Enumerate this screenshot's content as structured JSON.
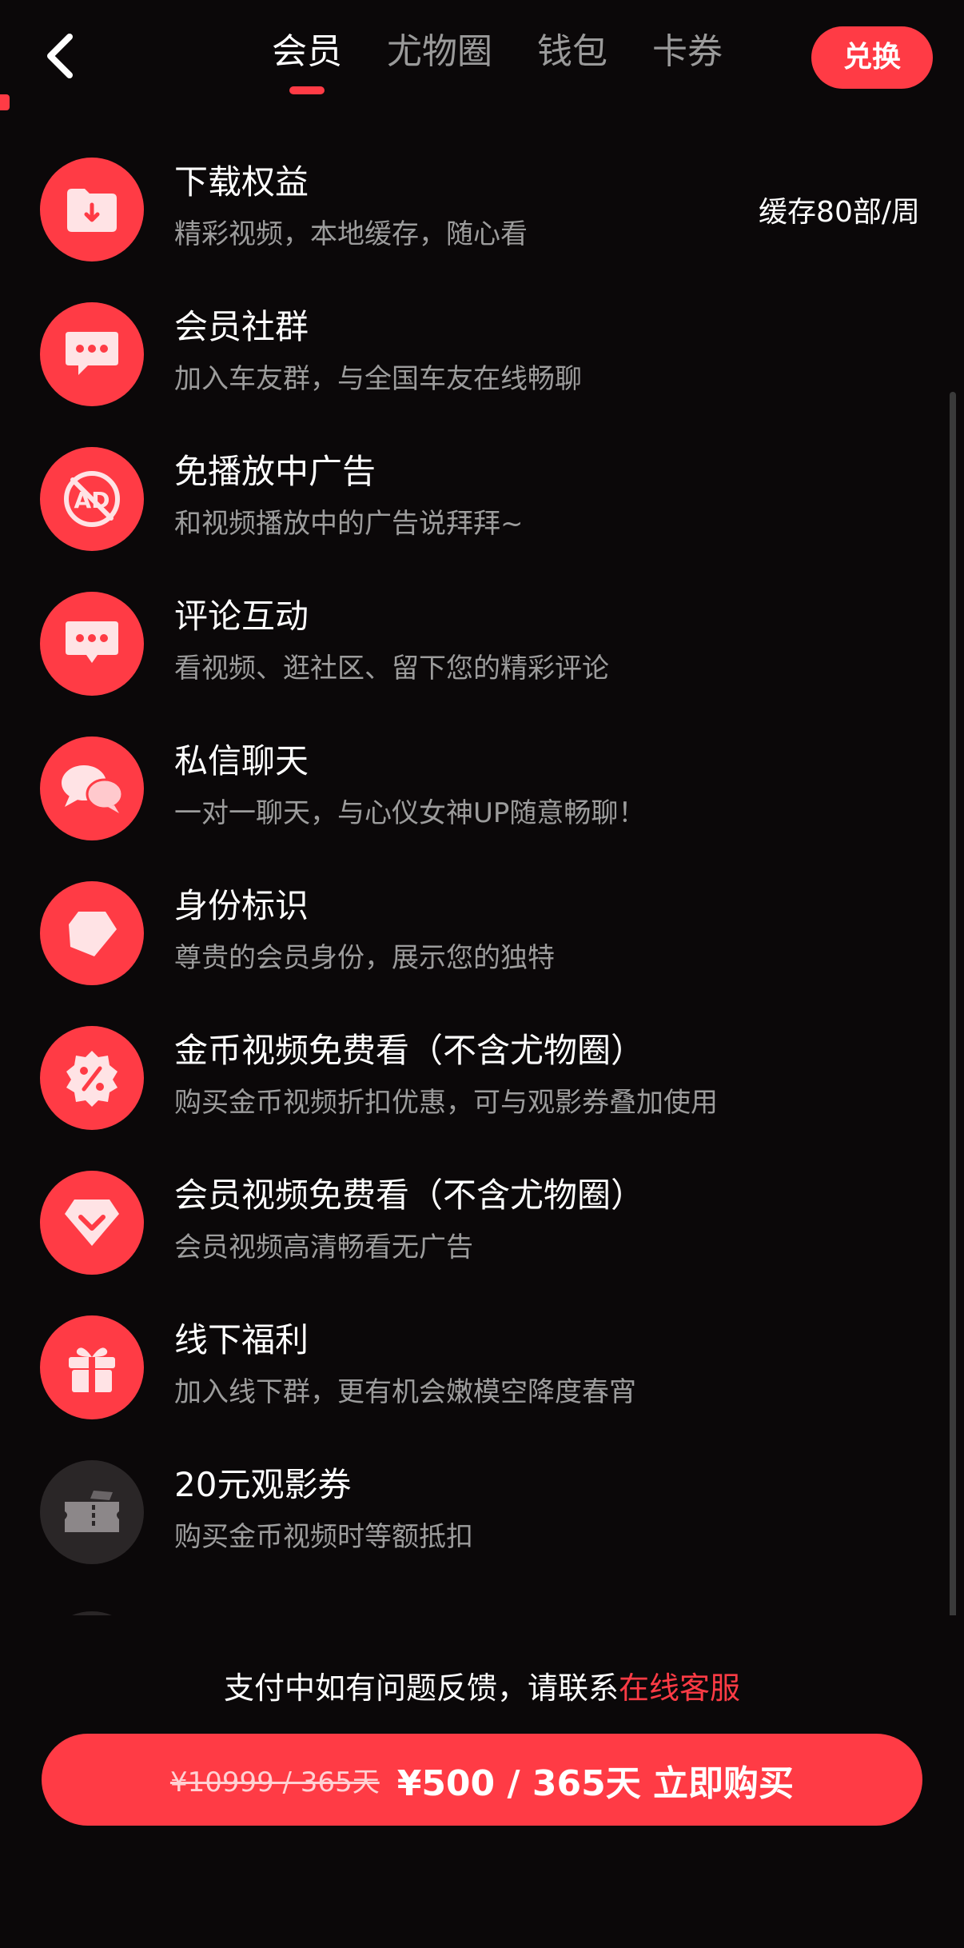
{
  "header": {
    "tabs": [
      {
        "label": "会员",
        "active": true
      },
      {
        "label": "尤物圈",
        "active": false
      },
      {
        "label": "钱包",
        "active": false
      },
      {
        "label": "卡券",
        "active": false
      }
    ],
    "redeem_label": "兑换"
  },
  "benefits": [
    {
      "title": "下载权益",
      "desc": "精彩视频，本地缓存，随心看",
      "extra": "缓存80部/周",
      "icon": "folder-download-icon"
    },
    {
      "title": "会员社群",
      "desc": "加入车友群，与全国车友在线畅聊",
      "icon": "chat-bubble-icon"
    },
    {
      "title": "免播放中广告",
      "desc": "和视频播放中的广告说拜拜~",
      "icon": "no-ad-icon"
    },
    {
      "title": "评论互动",
      "desc": "看视频、逛社区、留下您的精彩评论",
      "icon": "comment-icon"
    },
    {
      "title": "私信聊天",
      "desc": "一对一聊天，与心仪女神UP随意畅聊！",
      "icon": "private-message-icon"
    },
    {
      "title": "身份标识",
      "desc": "尊贵的会员身份，展示您的独特",
      "icon": "identity-badge-icon"
    },
    {
      "title": "金币视频免费看（不含尤物圈）",
      "desc": "购买金币视频折扣优惠，可与观影券叠加使用",
      "icon": "discount-badge-icon"
    },
    {
      "title": "会员视频免费看（不含尤物圈）",
      "desc": "会员视频高清畅看无广告",
      "icon": "diamond-icon"
    },
    {
      "title": "线下福利",
      "desc": "加入线下群，更有机会嫩模空降度春宵",
      "icon": "gift-icon"
    },
    {
      "title": "20元观影券",
      "desc": "购买金币视频时等额抵扣",
      "icon": "ticket-icon"
    }
  ],
  "footer": {
    "help_prefix": "支付中如有问题反馈，请联系",
    "help_link": "在线客服",
    "original_price": "¥10999 / 365天",
    "buy_label": "¥500 / 365天 立即购买"
  },
  "colors": {
    "accent": "#ff3b45",
    "background": "#0b0809",
    "muted_text": "#9c9c9c"
  }
}
